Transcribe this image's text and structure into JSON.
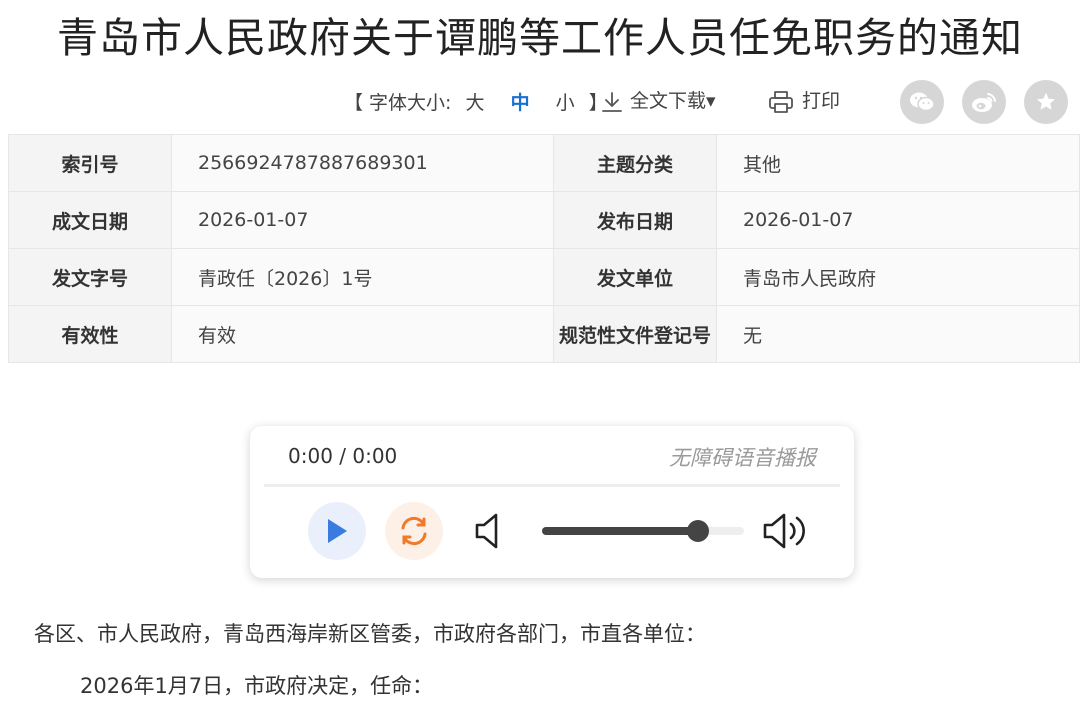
{
  "title": "青岛市人民政府关于谭鹏等工作人员任免职务的通知",
  "toolbar": {
    "font_size_prefix": "【 字体大小:",
    "font_size_large": "大",
    "font_size_medium": "中",
    "font_size_small": "小",
    "font_size_suffix": "】",
    "download_label": "全文下载▾",
    "print_label": "打印",
    "share_icons": [
      "wechat-icon",
      "weibo-icon",
      "favorite-icon"
    ],
    "active_color": "#1a6fd1"
  },
  "meta": {
    "rows": [
      [
        {
          "key": "索引号",
          "value": "2566924787887689301"
        },
        {
          "key": "主题分类",
          "value": "其他"
        }
      ],
      [
        {
          "key": "成文日期",
          "value": "2026-01-07"
        },
        {
          "key": "发布日期",
          "value": "2026-01-07"
        }
      ],
      [
        {
          "key": "发文字号",
          "value": "青政任〔2026〕1号"
        },
        {
          "key": "发文单位",
          "value": "青岛市人民政府"
        }
      ],
      [
        {
          "key": "有效性",
          "value": "有效"
        },
        {
          "key": "规范性文件登记号",
          "value": "无"
        }
      ]
    ]
  },
  "player": {
    "time": "0:00 / 0:00",
    "label": "无障碍语音播报",
    "volume": 0.77,
    "play_color": "#3a7be0",
    "loop_color": "#f07a2a"
  },
  "content": {
    "p1": "各区、市人民政府，青岛西海岸新区管委，市政府各部门，市直各单位：",
    "p2": "2026年1月7日，市政府决定，任命："
  }
}
